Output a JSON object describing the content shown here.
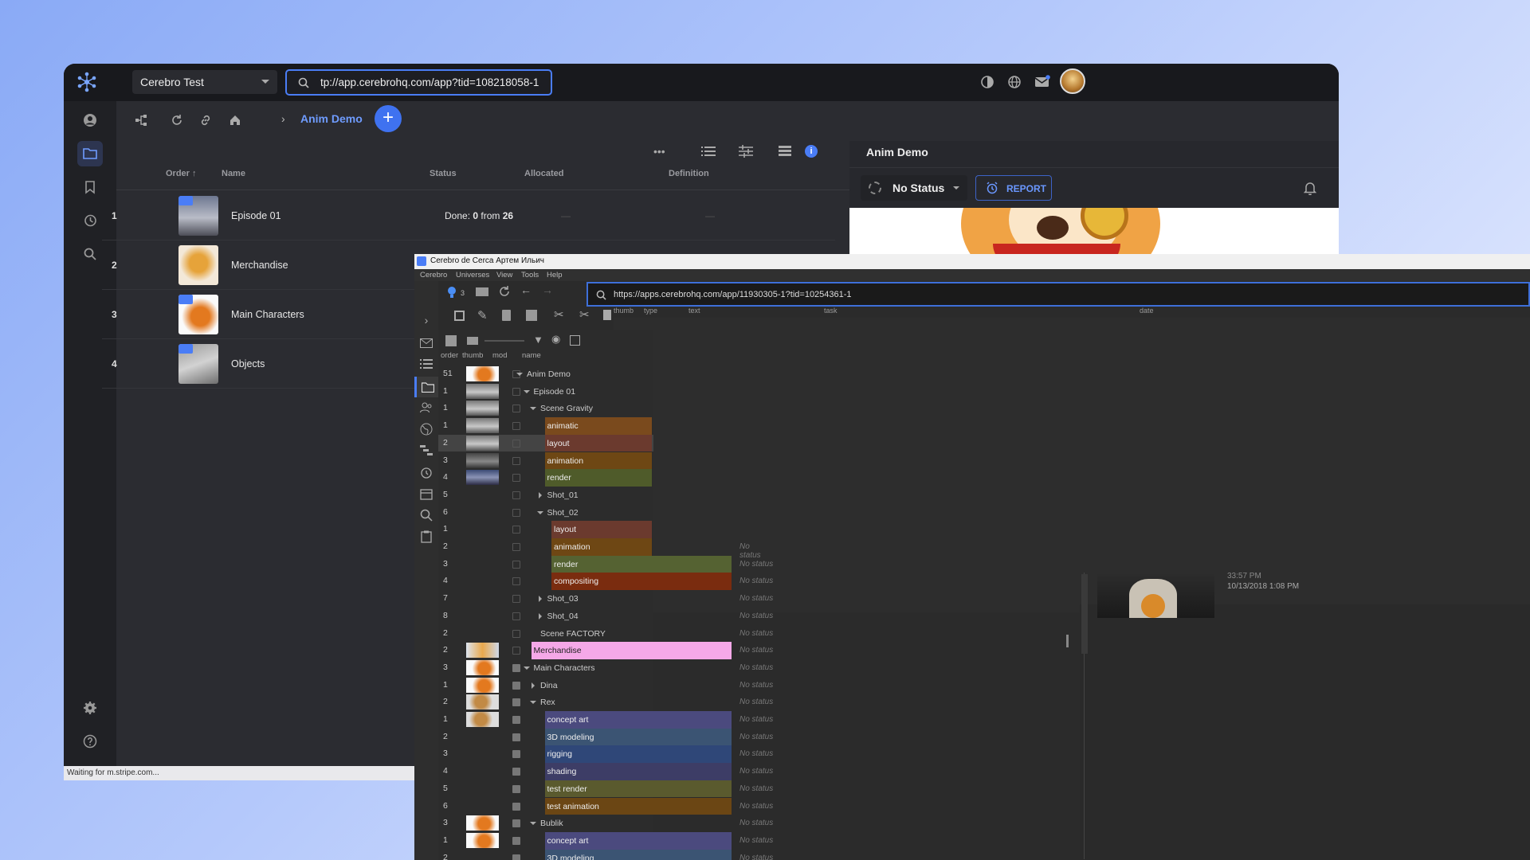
{
  "web": {
    "project": "Cerebro Test",
    "url": "tp://app.cerebrohq.com/app?tid=108218058-1",
    "breadcrumb": "Anim Demo",
    "columns": {
      "order": "Order",
      "name": "Name",
      "status": "Status",
      "allocated": "Allocated",
      "definition": "Definition"
    },
    "rows": [
      {
        "order": "1",
        "name": "Episode 01",
        "status_prefix": "Done:",
        "status_done": "0",
        "status_mid": "from",
        "status_total": "26",
        "dash": "—"
      },
      {
        "order": "2",
        "name": "Merchandise"
      },
      {
        "order": "3",
        "name": "Main Characters"
      },
      {
        "order": "4",
        "name": "Objects"
      }
    ],
    "panel": {
      "title": "Anim Demo",
      "status": "No Status",
      "report": "REPORT"
    },
    "statusbar": "Waiting for m.stripe.com..."
  },
  "desktop": {
    "title": "Cerebro de Cerca  Артем Ильич",
    "menu": [
      "Cerebro",
      "Universes",
      "View",
      "Tools",
      "Help"
    ],
    "url": "https://apps.cerebrohq.com/app/11930305-1?tid=10254361-1",
    "badge_count": "3",
    "grid_columns": [
      "thumb",
      "type",
      "text",
      "task",
      "date"
    ],
    "tree_columns": [
      "order",
      "thumb",
      "mod",
      "name"
    ],
    "no_status": "No status",
    "detail": {
      "time": "33:57 PM",
      "date": "10/13/2018 1:08 PM"
    },
    "tree": [
      {
        "order": "51",
        "name": "Anim Demo",
        "level": 0,
        "arrow": "down",
        "thumb": "fox"
      },
      {
        "order": "1",
        "name": "Episode 01",
        "level": 1,
        "arrow": "down",
        "thumb": "grey"
      },
      {
        "order": "1",
        "name": "Scene Gravity",
        "level": 2,
        "arrow": "down",
        "thumb": "grey"
      },
      {
        "order": "1",
        "name": "animatic",
        "level": 3,
        "color": "#7a4a1d",
        "thumb": "grey"
      },
      {
        "order": "2",
        "name": "layout",
        "level": 3,
        "color": "#6b3a2e",
        "thumb": "grey",
        "selected": true
      },
      {
        "order": "3",
        "name": "animation",
        "level": 3,
        "color": "#6e4714",
        "thumb": "dark"
      },
      {
        "order": "4",
        "name": "render",
        "level": 3,
        "color": "#4f5b2a",
        "thumb": "blue"
      },
      {
        "order": "5",
        "name": "Shot_01",
        "level": 3,
        "arrow": "right"
      },
      {
        "order": "6",
        "name": "Shot_02",
        "level": 3,
        "arrow": "down"
      },
      {
        "order": "1",
        "name": "layout",
        "level": 4,
        "color": "#6b3a2e"
      },
      {
        "order": "2",
        "name": "animation",
        "level": 4,
        "color": "#6e4714"
      },
      {
        "order": "3",
        "name": "render",
        "level": 4,
        "color": "#556232"
      },
      {
        "order": "4",
        "name": "compositing",
        "level": 4,
        "color": "#7a2c0f"
      },
      {
        "order": "7",
        "name": "Shot_03",
        "level": 3,
        "arrow": "right"
      },
      {
        "order": "8",
        "name": "Shot_04",
        "level": 3,
        "arrow": "right"
      },
      {
        "order": "2",
        "name": "Scene FACTORY",
        "level": 2
      },
      {
        "order": "2",
        "name": "Merchandise",
        "level": 1,
        "color": "#f5a8e8",
        "dark_text": true,
        "thumb": "merch"
      },
      {
        "order": "3",
        "name": "Main Characters",
        "level": 1,
        "arrow": "down",
        "thumb": "fox"
      },
      {
        "order": "1",
        "name": "Dina",
        "level": 2,
        "arrow": "right",
        "thumb": "fox"
      },
      {
        "order": "2",
        "name": "Rex",
        "level": 2,
        "arrow": "down",
        "thumb": "rex"
      },
      {
        "order": "1",
        "name": "concept art",
        "level": 3,
        "color": "#4b4a7e",
        "thumb": "rex"
      },
      {
        "order": "2",
        "name": "3D modeling",
        "level": 3,
        "color": "#3b5473"
      },
      {
        "order": "3",
        "name": "rigging",
        "level": 3,
        "color": "#2f4778"
      },
      {
        "order": "4",
        "name": "shading",
        "level": 3,
        "color": "#3d3d66"
      },
      {
        "order": "5",
        "name": "test render",
        "level": 3,
        "color": "#5a5a2e"
      },
      {
        "order": "6",
        "name": "test animation",
        "level": 3,
        "color": "#6b4614"
      },
      {
        "order": "3",
        "name": "Bublik",
        "level": 2,
        "arrow": "down",
        "thumb": "fox"
      },
      {
        "order": "1",
        "name": "concept art",
        "level": 3,
        "color": "#4b4a7e",
        "thumb": "fox"
      },
      {
        "order": "2",
        "name": "3D modeling",
        "level": 3,
        "color": "#3b5473"
      }
    ]
  }
}
